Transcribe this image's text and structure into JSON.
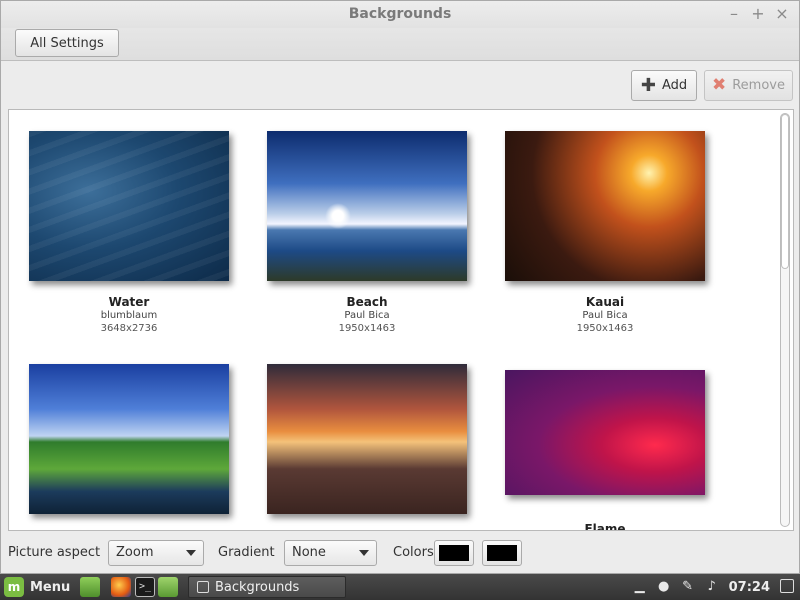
{
  "window": {
    "title": "Backgrounds",
    "controls": {
      "minimize": "–",
      "maximize": "+",
      "close": "×"
    }
  },
  "toolbar": {
    "all_settings": "All Settings"
  },
  "actions": {
    "add": "Add",
    "remove": "Remove"
  },
  "backgrounds": [
    {
      "name": "Water",
      "author": "blumblaum",
      "size": "3648x2736"
    },
    {
      "name": "Beach",
      "author": "Paul Bica",
      "size": "1950x1463"
    },
    {
      "name": "Kauai",
      "author": "Paul Bica",
      "size": "1950x1463"
    },
    {
      "name": "",
      "author": "",
      "size": ""
    },
    {
      "name": "",
      "author": "",
      "size": ""
    },
    {
      "name": "Flame",
      "author": "",
      "size": ""
    }
  ],
  "options": {
    "picture_aspect_label": "Picture aspect",
    "picture_aspect_value": "Zoom",
    "gradient_label": "Gradient",
    "gradient_value": "None",
    "colors_label": "Colors",
    "color1": "#000000",
    "color2": "#000000"
  },
  "panel": {
    "menu_label": "Menu",
    "task_label": "Backgrounds",
    "clock": "07:24"
  },
  "icons": {
    "add": "plus-icon",
    "remove": "x-icon",
    "launcher_1": "desktop-icon",
    "launcher_2": "firefox-icon",
    "launcher_3": "terminal-icon",
    "launcher_4": "folder-icon"
  }
}
